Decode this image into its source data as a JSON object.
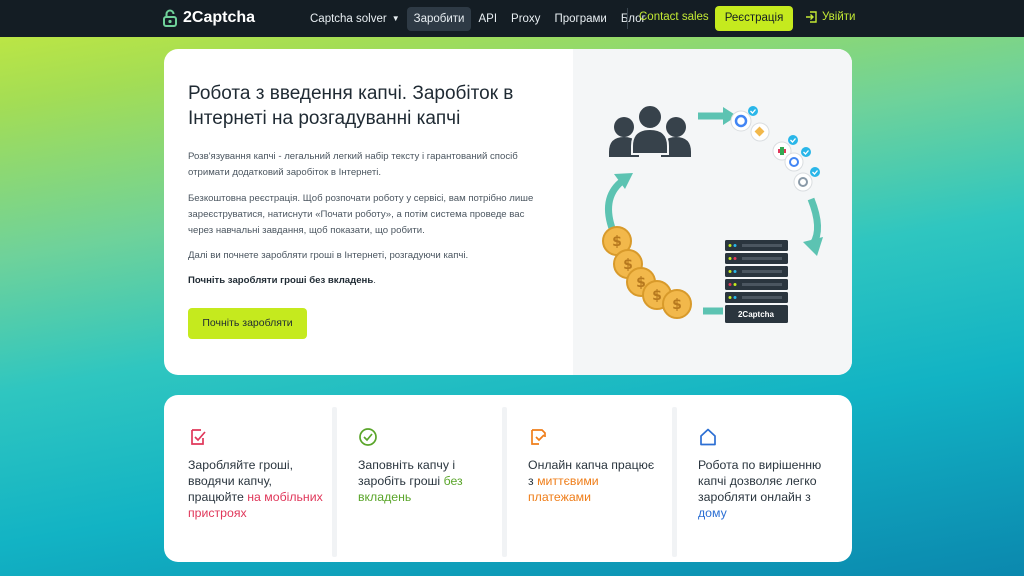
{
  "nav": {
    "logo_text": "2Captcha",
    "items": [
      "Captcha solver",
      "Заробити",
      "API",
      "Proxy",
      "Програми",
      "Блог"
    ],
    "contact_sales": "Contact sales",
    "register": "Реєстрація",
    "login": "Увійти"
  },
  "hero": {
    "title": "Робота з введення капчі. Заробіток в Інтернеті на розгадуванні капчі",
    "p1": "Розв'язування капчі - легальний легкий набір тексту і гарантований спосіб отримати додатковий заробіток в Інтернеті.",
    "p2": "Безкоштовна реєстрація. Щоб розпочати роботу у сервісі, вам потрібно лише зареєструватися, натиснути «Почати роботу», а потім система проведе вас через навчальні завдання, щоб показати, що робити.",
    "p3": "Далі ви почнете заробляти гроші в Інтернеті, розгадуючи капчі.",
    "p4": "Почніть заробляти гроші без вкладень",
    "p4_end": ".",
    "cta": "Почніть заробляти",
    "server_label": "2Captcha"
  },
  "features": [
    {
      "icon": "edit-check-icon",
      "color": "#e0375a",
      "text": "Заробляйте гроші, вводячи капчу, працюйте ",
      "highlight": "на мобільних пристроях",
      "text_after": ""
    },
    {
      "icon": "check-circle-icon",
      "color": "#5aa52a",
      "text": "Заповніть капчу і заробіть гроші ",
      "highlight": "без вкладень",
      "text_after": ""
    },
    {
      "icon": "edit-arrow-icon",
      "color": "#ef7e1a",
      "text": "Онлайн капча працює з ",
      "highlight": "миттєвими платежами",
      "text_after": ""
    },
    {
      "icon": "home-icon",
      "color": "#2c6fd3",
      "text": "Робота по вирішенню капчі дозволяє легко заробляти онлайн з ",
      "highlight": "дому",
      "text_after": ""
    }
  ]
}
